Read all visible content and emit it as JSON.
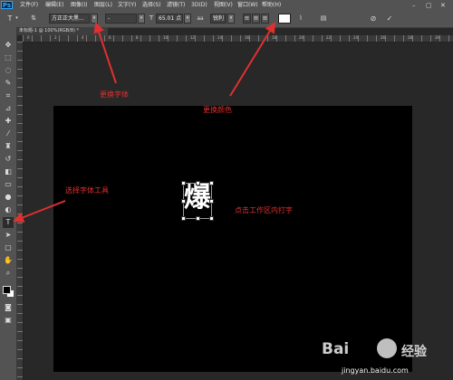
{
  "menubar": {
    "logo": "Ps",
    "items": [
      "文件(F)",
      "编辑(E)",
      "图像(I)",
      "图层(L)",
      "文字(Y)",
      "选择(S)",
      "滤镜(T)",
      "3D(D)",
      "视图(V)",
      "窗口(W)",
      "帮助(H)"
    ]
  },
  "options": {
    "tool_icon": "type-tool-icon",
    "font_family": "方正正大黑...",
    "font_style": "-",
    "font_size": "65.01 点",
    "aa_label": "aa",
    "aa_mode": "锐利",
    "text_color": "#ffffff"
  },
  "document": {
    "tab_title": "未标题-1 @ 100%(RGB/8) *",
    "ruler_ticks": [
      "0",
      "2",
      "4",
      "6",
      "8",
      "10",
      "12",
      "14",
      "16",
      "18",
      "20",
      "22",
      "24",
      "26",
      "28",
      "30"
    ],
    "text_glyph": "爆"
  },
  "annotations": {
    "change_font": "更换字体",
    "change_color": "更换颜色",
    "select_type_tool": "选择字体工具",
    "click_canvas": "点击工作区内打字"
  },
  "colors": {
    "annotation": "#e03030",
    "canvas": "#000000",
    "chrome": "#535353"
  },
  "watermark": {
    "brand": "Bai",
    "brand_cn": "经验",
    "url": "jingyan.baidu.com"
  }
}
